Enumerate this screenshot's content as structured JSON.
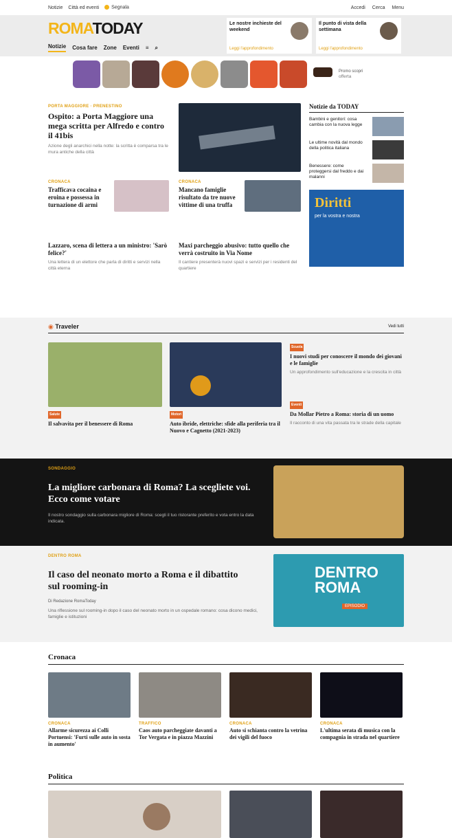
{
  "topbar": {
    "left": [
      "Notizie",
      "Città ed eventi",
      "Segnala"
    ],
    "right": [
      "Accedi",
      "Cerca",
      "Menu"
    ]
  },
  "header": {
    "logo_roma": "ROMA",
    "logo_today": "TODAY",
    "nav": [
      "Notizie",
      "Cosa fare",
      "Zone",
      "Eventi"
    ],
    "card1_title": "Le nostre inchieste del weekend",
    "card1_more": "Leggi l'approfondimento",
    "card2_title": "Il punto di vista della settimana",
    "card2_more": "Leggi l'approfondimento"
  },
  "promo": {
    "label": "Promo scopri",
    "sub": "offerta"
  },
  "main": {
    "kicker": "Porta Maggiore · Prenestino",
    "title": "Ospito: a Porta Maggiore una mega scritta per Alfredo e contro il 41bis",
    "summary": "Azione degli anarchici nella notte: la scritta è comparsa tra le mura antiche della città",
    "b1_kicker": "Cronaca",
    "b1_title": "Trafficava cocaina e eroina e possessa in turnazione di armi",
    "b2_kicker": "Cronaca",
    "b2_title": "Mancano famiglie risultato da tre nuove vittime di una truffa",
    "b3_title": "Lazzaro, scena di lettera a un ministro: 'Sarò felice?'",
    "b3_summary": "Una lettera di un elettore che parla di diritti e servizi nella città eterna",
    "b4_title": "Maxi parcheggio abusivo: tutto quello che verrà costruito in Via Nome",
    "b4_summary": "Il cantiere presenterà nuovi spazi e servizi per i residenti del quartiere"
  },
  "sidebar": {
    "title": "Notizie da TODAY",
    "items": [
      "Bambini e genitori: cosa cambia con la nuova legge",
      "Le ultime novità dal mondo della politica italiana",
      "Benessere: come proteggersi dal freddo e dai malanni"
    ],
    "ad_title": "Diritti",
    "ad_sub": "per la vostra e nostra"
  },
  "traveler": {
    "label": "Traveler",
    "more": "Vedi tutti",
    "a1_kicker": "Salute",
    "a1_title": "Il salvavita per il benessere di Roma",
    "a2_kicker": "Motori",
    "a2_title": "Auto ibride, elettriche: sfide alla periferia tra il Nuovo e Cagnetto (2021-2023)",
    "a3_kicker": "Scuola",
    "a3_title": "I nuovi studi per conoscere il mondo dei giovani e le famiglie",
    "a3_summary": "Un approfondimento sull'educazione e la crescita in città",
    "a4_kicker": "Eventi",
    "a4_title": "Da Mollar Pietro a Roma: storia di un uomo",
    "a4_summary": "Il racconto di una vita passata tra le strade della capitale"
  },
  "dark": {
    "kicker": "Sondaggio",
    "title": "La migliore carbonara di Roma? La scegliete voi. Ecco come votare",
    "summary": "Il nostro sondaggio sulla carbonara migliore di Roma: scegli il tuo ristorante preferito e vota entro la data indicata."
  },
  "feature": {
    "kicker": "Dentro Roma",
    "title": "Il caso del neonato morto a Roma e il dibattito sul rooming-in",
    "byline": "Di Redazione RomaToday",
    "summary": "Una riflessione sul rooming-in dopo il caso del neonato morto in un ospedale romano: cosa dicono medici, famiglie e istituzioni",
    "image_text": "DENTRO ROMA",
    "image_sub": "EPISODIO"
  },
  "cronaca": {
    "title": "Cronaca",
    "items": [
      {
        "kicker": "Cronaca",
        "title": "Allarme sicurezza ai Colli Portuensi: 'Furti sulle auto in sosta in aumento'"
      },
      {
        "kicker": "Traffico",
        "title": "Caos auto parcheggiate davanti a Tor Vergata e in piazza Mazzini"
      },
      {
        "kicker": "Cronaca",
        "title": "Auto si schianta contro la vetrina dei vigili del fuoco"
      },
      {
        "kicker": "Cronaca",
        "title": "L'ultima serata di musica con la compagnia in strada nel quartiere"
      }
    ]
  },
  "politica": {
    "title": "Politica"
  }
}
